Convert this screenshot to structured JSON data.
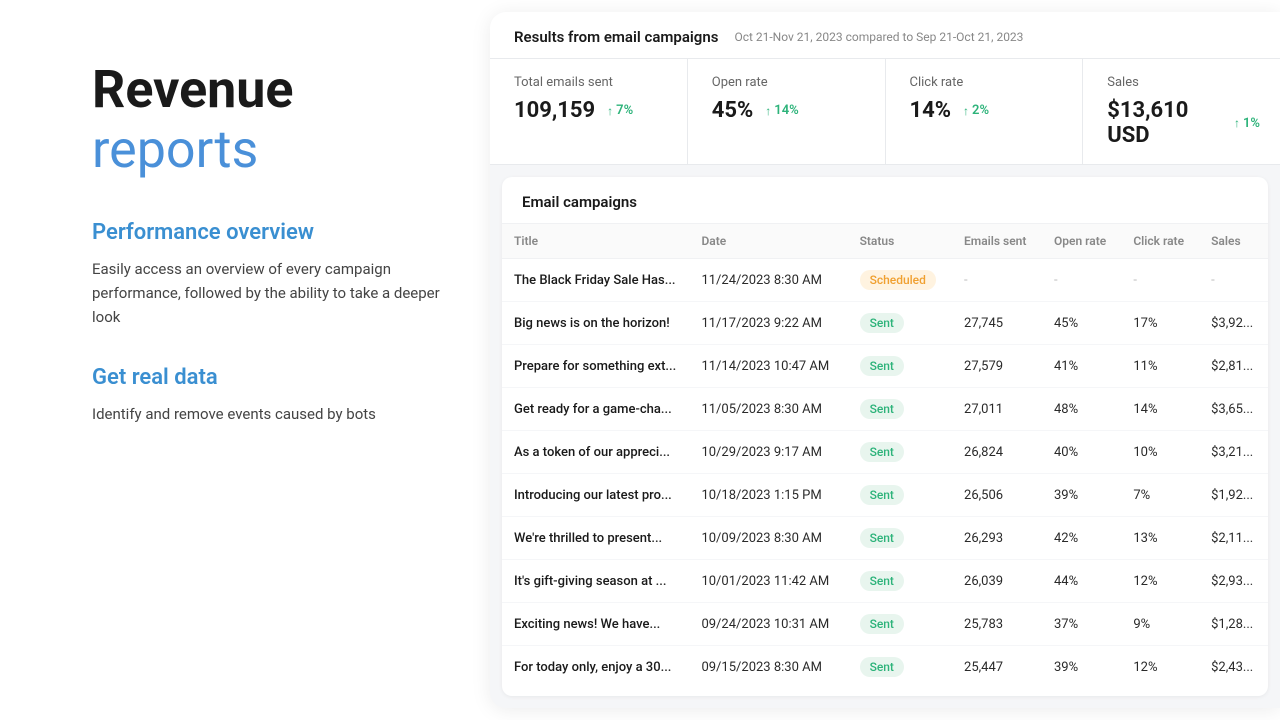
{
  "left": {
    "title_black": "Revenue",
    "title_blue": "reports",
    "sections": [
      {
        "heading": "Performance overview",
        "description": "Easily access an overview of every campaign performance, followed by the ability to take a deeper look"
      },
      {
        "heading": "Get real data",
        "description": "Identify and remove events caused by bots"
      }
    ]
  },
  "right": {
    "header": {
      "title": "Results from email campaigns",
      "date_range": "Oct 21-Nov 21, 2023 compared to Sep 21-Oct 21, 2023"
    },
    "stats": [
      {
        "label": "Total emails sent",
        "value": "109,159",
        "change": "7%"
      },
      {
        "label": "Open rate",
        "value": "45%",
        "change": "14%"
      },
      {
        "label": "Click rate",
        "value": "14%",
        "change": "2%"
      },
      {
        "label": "Sales",
        "value": "$13,610 USD",
        "change": "1%"
      }
    ],
    "campaigns": {
      "title": "Email campaigns",
      "columns": [
        "Title",
        "Date",
        "Status",
        "Emails sent",
        "Open rate",
        "Click rate",
        "Sales"
      ],
      "rows": [
        {
          "title": "The Black Friday Sale Has...",
          "date": "11/24/2023 8:30 AM",
          "status": "Scheduled",
          "emails_sent": "-",
          "open_rate": "-",
          "click_rate": "-",
          "sales": "-"
        },
        {
          "title": "Big news is on the horizon!",
          "date": "11/17/2023 9:22 AM",
          "status": "Sent",
          "emails_sent": "27,745",
          "open_rate": "45%",
          "click_rate": "17%",
          "sales": "$3,92..."
        },
        {
          "title": "Prepare for something ext...",
          "date": "11/14/2023 10:47 AM",
          "status": "Sent",
          "emails_sent": "27,579",
          "open_rate": "41%",
          "click_rate": "11%",
          "sales": "$2,81..."
        },
        {
          "title": "Get ready for a game-cha...",
          "date": "11/05/2023 8:30 AM",
          "status": "Sent",
          "emails_sent": "27,011",
          "open_rate": "48%",
          "click_rate": "14%",
          "sales": "$3,65..."
        },
        {
          "title": "As a token of our appreci...",
          "date": "10/29/2023 9:17 AM",
          "status": "Sent",
          "emails_sent": "26,824",
          "open_rate": "40%",
          "click_rate": "10%",
          "sales": "$3,21..."
        },
        {
          "title": "Introducing our latest pro...",
          "date": "10/18/2023 1:15 PM",
          "status": "Sent",
          "emails_sent": "26,506",
          "open_rate": "39%",
          "click_rate": "7%",
          "sales": "$1,92..."
        },
        {
          "title": "We're thrilled to present...",
          "date": "10/09/2023 8:30 AM",
          "status": "Sent",
          "emails_sent": "26,293",
          "open_rate": "42%",
          "click_rate": "13%",
          "sales": "$2,11..."
        },
        {
          "title": "It's gift-giving season at ...",
          "date": "10/01/2023 11:42 AM",
          "status": "Sent",
          "emails_sent": "26,039",
          "open_rate": "44%",
          "click_rate": "12%",
          "sales": "$2,93..."
        },
        {
          "title": "Exciting news! We have...",
          "date": "09/24/2023 10:31 AM",
          "status": "Sent",
          "emails_sent": "25,783",
          "open_rate": "37%",
          "click_rate": "9%",
          "sales": "$1,28..."
        },
        {
          "title": "For today only, enjoy a 30...",
          "date": "09/15/2023 8:30 AM",
          "status": "Sent",
          "emails_sent": "25,447",
          "open_rate": "39%",
          "click_rate": "12%",
          "sales": "$2,43..."
        }
      ]
    }
  }
}
